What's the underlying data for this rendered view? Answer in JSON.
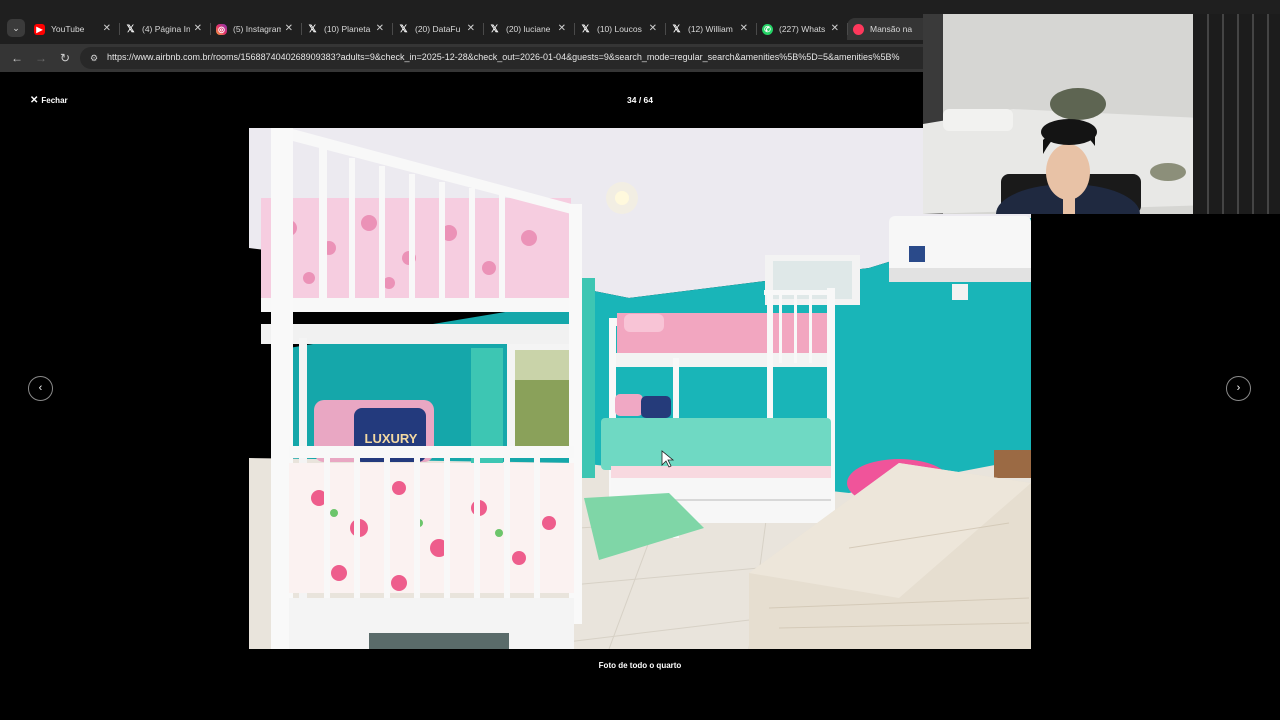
{
  "browser": {
    "tabs": [
      {
        "title": "YouTube",
        "favicon": "youtube-icon"
      },
      {
        "title": "(4) Página In",
        "favicon": "x-icon"
      },
      {
        "title": "(5) Instagram",
        "favicon": "instagram-icon"
      },
      {
        "title": "(10) Planeta",
        "favicon": "x-icon"
      },
      {
        "title": "(20) DataFu",
        "favicon": "x-icon"
      },
      {
        "title": "(20) luciane",
        "favicon": "x-icon"
      },
      {
        "title": "(10) Loucos",
        "favicon": "x-icon"
      },
      {
        "title": "(12) William",
        "favicon": "x-icon"
      },
      {
        "title": "(227) Whats",
        "favicon": "whatsapp-icon"
      },
      {
        "title": "Mansão na",
        "favicon": "airbnb-icon",
        "active": true
      }
    ],
    "url": "https://www.airbnb.com.br/rooms/1568874040268909383?adults=9&check_in=2025-12-28&check_out=2026-01-04&guests=9&search_mode=regular_search&amenities%5B%5D=5&amenities%5B%"
  },
  "gallery": {
    "close_label": "Fechar",
    "counter": "34 / 64",
    "caption": "Foto de todo o quarto",
    "pillow_text": "LUXURY"
  },
  "colors": {
    "wall": "#19b5b8",
    "background": "#000000",
    "tabbar": "#1f1f1f",
    "toolbar": "#353535"
  }
}
